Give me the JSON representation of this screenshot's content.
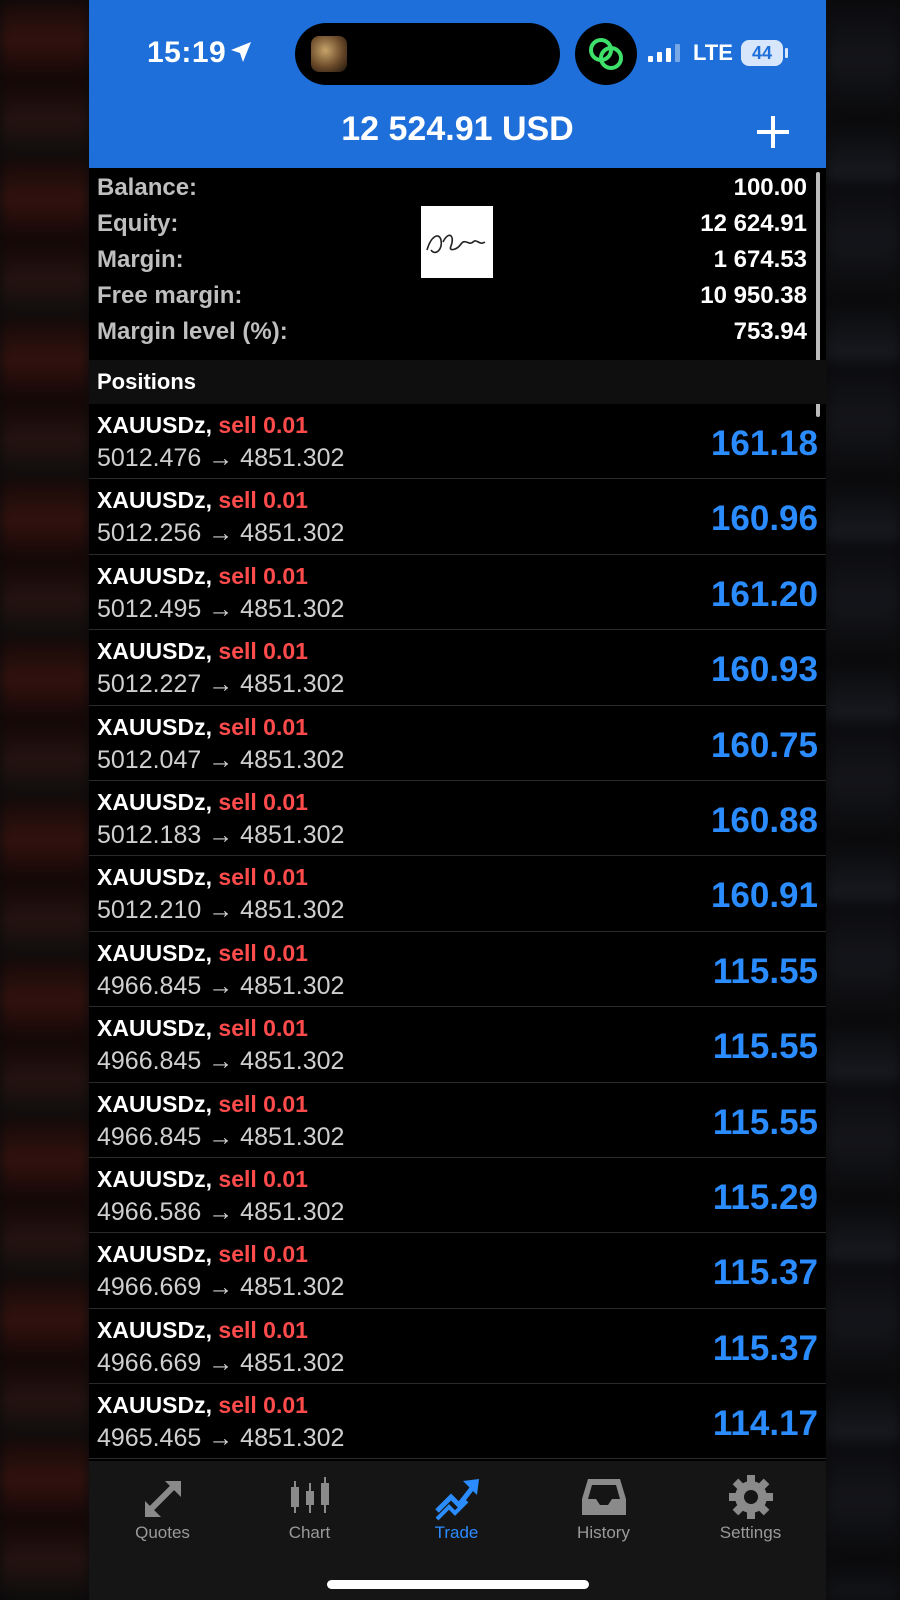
{
  "status_bar": {
    "time": "15:19",
    "network": "LTE",
    "battery": "44"
  },
  "header": {
    "total": "12 524.91 USD"
  },
  "summary": [
    {
      "label": "Balance:",
      "value": "100.00"
    },
    {
      "label": "Equity:",
      "value": "12 624.91"
    },
    {
      "label": "Margin:",
      "value": "1 674.53"
    },
    {
      "label": "Free margin:",
      "value": "10 950.38"
    },
    {
      "label": "Margin level (%):",
      "value": "753.94"
    }
  ],
  "positions": {
    "heading": "Positions",
    "items": [
      {
        "symbol": "XAUUSDz,",
        "side": "sell 0.01",
        "prices": "5012.476 → 4851.302",
        "profit": "161.18"
      },
      {
        "symbol": "XAUUSDz,",
        "side": "sell 0.01",
        "prices": "5012.256 → 4851.302",
        "profit": "160.96"
      },
      {
        "symbol": "XAUUSDz,",
        "side": "sell 0.01",
        "prices": "5012.495 → 4851.302",
        "profit": "161.20"
      },
      {
        "symbol": "XAUUSDz,",
        "side": "sell 0.01",
        "prices": "5012.227 → 4851.302",
        "profit": "160.93"
      },
      {
        "symbol": "XAUUSDz,",
        "side": "sell 0.01",
        "prices": "5012.047 → 4851.302",
        "profit": "160.75"
      },
      {
        "symbol": "XAUUSDz,",
        "side": "sell 0.01",
        "prices": "5012.183 → 4851.302",
        "profit": "160.88"
      },
      {
        "symbol": "XAUUSDz,",
        "side": "sell 0.01",
        "prices": "5012.210 → 4851.302",
        "profit": "160.91"
      },
      {
        "symbol": "XAUUSDz,",
        "side": "sell 0.01",
        "prices": "4966.845 → 4851.302",
        "profit": "115.55"
      },
      {
        "symbol": "XAUUSDz,",
        "side": "sell 0.01",
        "prices": "4966.845 → 4851.302",
        "profit": "115.55"
      },
      {
        "symbol": "XAUUSDz,",
        "side": "sell 0.01",
        "prices": "4966.845 → 4851.302",
        "profit": "115.55"
      },
      {
        "symbol": "XAUUSDz,",
        "side": "sell 0.01",
        "prices": "4966.586 → 4851.302",
        "profit": "115.29"
      },
      {
        "symbol": "XAUUSDz,",
        "side": "sell 0.01",
        "prices": "4966.669 → 4851.302",
        "profit": "115.37"
      },
      {
        "symbol": "XAUUSDz,",
        "side": "sell 0.01",
        "prices": "4966.669 → 4851.302",
        "profit": "115.37"
      },
      {
        "symbol": "XAUUSDz,",
        "side": "sell 0.01",
        "prices": "4965.465 → 4851.302",
        "profit": "114.17"
      }
    ]
  },
  "tabs": [
    {
      "label": "Quotes",
      "icon": "quotes-icon"
    },
    {
      "label": "Chart",
      "icon": "chart-icon"
    },
    {
      "label": "Trade",
      "icon": "trade-icon",
      "active": true
    },
    {
      "label": "History",
      "icon": "history-icon"
    },
    {
      "label": "Settings",
      "icon": "settings-icon"
    }
  ],
  "colors": {
    "accent": "#1e6fd9",
    "profit": "#2b8cff",
    "sell": "#ff4b4b"
  }
}
